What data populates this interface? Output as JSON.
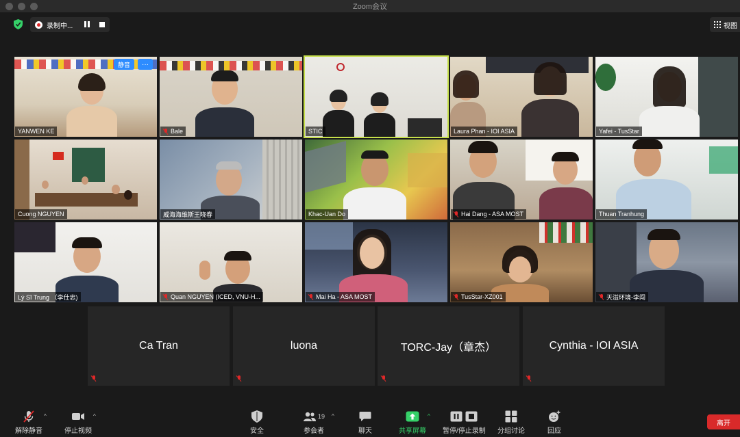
{
  "window": {
    "title": "Zoom会议"
  },
  "topbar": {
    "recording_label": "录制中...",
    "view_label": "视图"
  },
  "self_overlay": {
    "mute_label": "静音",
    "more_label": "···"
  },
  "video_tiles": [
    {
      "name": "YANWEN KE",
      "muted": false
    },
    {
      "name": "Bale",
      "muted": true
    },
    {
      "name": "STIC",
      "muted": false
    },
    {
      "name": "Laura Phan - IOI ASIA",
      "muted": false
    },
    {
      "name": "Yafei - TusStar",
      "muted": false
    },
    {
      "name": "Cuong NGUYEN",
      "muted": false
    },
    {
      "name": "威海海维斯王晓春",
      "muted": false
    },
    {
      "name": "Khac-Uan Do",
      "muted": false
    },
    {
      "name": "Hai Dang - ASA MOST",
      "muted": true
    },
    {
      "name": "Thuan Tranhung",
      "muted": false
    },
    {
      "name": "Lý Sĩ Trung （李仕忠)",
      "muted": false
    },
    {
      "name": "Quan NGUYEN (ICED, VNU-H...",
      "muted": true
    },
    {
      "name": "Mai Ha - ASA MOST",
      "muted": true
    },
    {
      "name": "TusStar-XZ001",
      "muted": true
    },
    {
      "name": "天溢环境-李闯",
      "muted": true
    }
  ],
  "audio_tiles": [
    {
      "name": "Ca Tran"
    },
    {
      "name": "luona"
    },
    {
      "name": "TORC-Jay（章杰）"
    },
    {
      "name": "Cynthia - IOI ASIA"
    }
  ],
  "toolbar": {
    "unmute": "解除静音",
    "stop_video": "停止视频",
    "security": "安全",
    "participants": "参会者",
    "participants_count": "19",
    "chat": "聊天",
    "share": "共享屏幕",
    "record": "暂停/停止录制",
    "breakout": "分组讨论",
    "reactions": "回应",
    "leave": "离开"
  },
  "colors": {
    "active_speaker": "#c7e04b",
    "share_green": "#35d068",
    "leave_red": "#d92a2a",
    "overlay_blue": "#2d8cff"
  }
}
